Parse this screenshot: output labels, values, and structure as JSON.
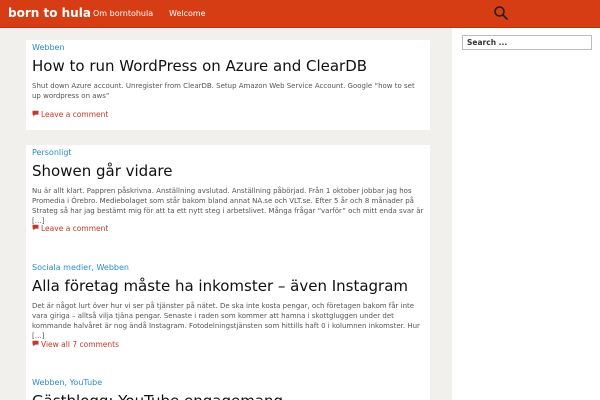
{
  "header": {
    "brand": "born to hula",
    "nav": [
      "Om borntohula",
      "Welcome"
    ]
  },
  "sidebar": {
    "search_placeholder": "Search ..."
  },
  "posts": [
    {
      "categories": [
        "Webben"
      ],
      "title": "How to run WordPress on Azure and ClearDB",
      "excerpt": "Shut down Azure account. Unregister from ClearDB. Setup Amazon Web Service Account. Google “how to set up wordpress on aws”",
      "comments": "Leave a comment"
    },
    {
      "categories": [
        "Personligt"
      ],
      "title": "Showen går vidare",
      "excerpt": "Nu är allt klart. Pappren påskrivna. Anställning avslutad. Anställning påbörjad. Från 1 oktober jobbar jag hos Promedia i Örebro. Mediebolaget som står bakom bland annat NA.se och VLT.se. Efter 5 år och 8 månader på Strateg så har jag bestämt mig för att ta ett nytt steg i arbetslivet. Många frågar “varför” och mitt enda svar är […]",
      "comments": "Leave a comment"
    },
    {
      "categories": [
        "Sociala medier",
        "Webben"
      ],
      "title": "Alla företag måste ha inkomster – även Instagram",
      "excerpt": "Det är något lurt över hur vi ser på tjänster på nätet. De ska inte kosta pengar, och företagen bakom får inte vara giriga – alltså vilja tjäna pengar. Senaste i raden som kommer att hamna i skottgluggen under det kommande halvåret är nog ändå Instagram. Fotodelningstjänsten som hittills haft 0 i kolumnen inkomster. Hur […]",
      "comments": "View all 7 comments"
    },
    {
      "categories": [
        "Webben",
        "YouTube"
      ],
      "title": "Gästblogg: YouTube engagemang",
      "excerpt": "",
      "comments": ""
    }
  ],
  "icons": {
    "search": "search-icon",
    "comment": "comment-icon"
  },
  "colors": {
    "header_bg": "#d73d15",
    "link": "#2a8bc5",
    "comment_link": "#c0392b",
    "page_bg": "#f2f0ed"
  }
}
